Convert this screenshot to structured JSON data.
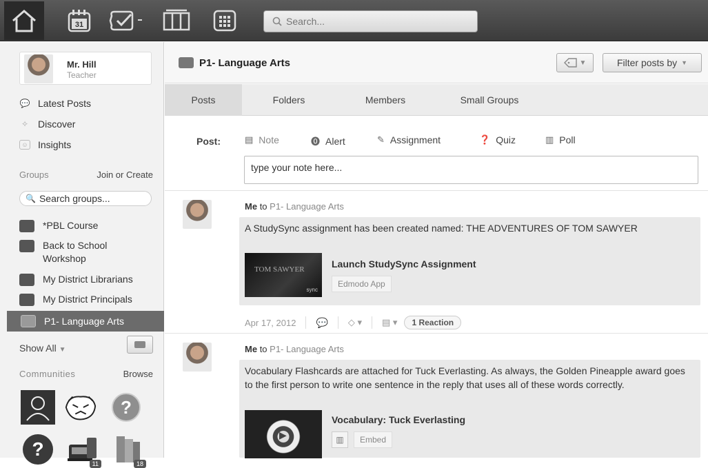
{
  "topbar": {
    "calendar_day": "31",
    "search_placeholder": "Search..."
  },
  "sidebar": {
    "profile": {
      "name": "Mr. Hill",
      "role": "Teacher"
    },
    "links": [
      {
        "label": "Latest Posts",
        "icon": "speech-bubble-icon"
      },
      {
        "label": "Discover",
        "icon": "compass-icon"
      },
      {
        "label": "Insights",
        "icon": "insights-icon"
      }
    ],
    "groups_label": "Groups",
    "join_create": "Join or Create",
    "group_search_placeholder": "Search groups...",
    "groups": [
      {
        "label": "*PBL Course"
      },
      {
        "label": "Back to School Workshop"
      },
      {
        "label": "My District Librarians"
      },
      {
        "label": "My District Principals"
      },
      {
        "label": "P1- Language Arts",
        "active": true
      }
    ],
    "show_all": "Show All",
    "communities_label": "Communities",
    "browse": "Browse",
    "community_badges": [
      "11",
      "18"
    ]
  },
  "main": {
    "group_title": "P1- Language Arts",
    "filter_label": "Filter posts by",
    "tabs": [
      "Posts",
      "Folders",
      "Members",
      "Small Groups"
    ],
    "composer": {
      "label": "Post:",
      "types": [
        "Note",
        "Alert",
        "Assignment",
        "Quiz",
        "Poll"
      ],
      "placeholder": "type your note here..."
    },
    "posts": [
      {
        "author": "Me",
        "to": "to",
        "group": "P1- Language Arts",
        "text": "A StudySync assignment has been created named: THE ADVENTURES OF TOM SAWYER",
        "attachment_title": "Launch StudySync Assignment",
        "attachment_sub": "Edmodo App",
        "thumb_text": "TOM SAWYER",
        "thumb_brand": "sync",
        "date": "Apr 17, 2012",
        "reaction": "1 Reaction"
      },
      {
        "author": "Me",
        "to": "to",
        "group": "P1- Language Arts",
        "text": "Vocabulary Flashcards are attached for Tuck Everlasting. As always, the Golden Pineapple award goes to the first person to write one sentence in the reply that uses all of these words correctly.",
        "attachment_title": "Vocabulary: Tuck Everlasting",
        "attachment_sub": "Embed"
      }
    ]
  }
}
